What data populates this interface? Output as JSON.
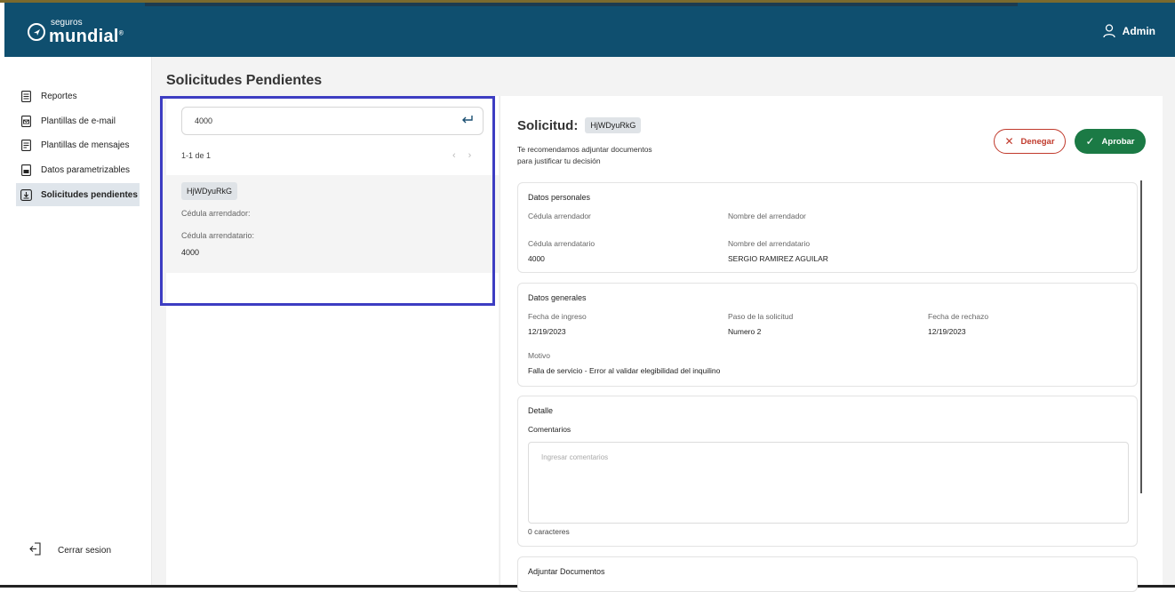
{
  "header": {
    "brand_small": "seguros",
    "brand_big": "mundial",
    "brand_mark": "®",
    "user_label": "Admin"
  },
  "sidebar": {
    "items": [
      {
        "label": "Reportes",
        "icon": "document-icon"
      },
      {
        "label": "Plantillas de e-mail",
        "icon": "email-template-icon"
      },
      {
        "label": "Plantillas de mensajes",
        "icon": "message-template-icon"
      },
      {
        "label": "Datos parametrizables",
        "icon": "settings-data-icon"
      },
      {
        "label": "Solicitudes pendientes",
        "icon": "pending-requests-icon",
        "active": true
      }
    ],
    "logout_label": "Cerrar sesion"
  },
  "page": {
    "title": "Solicitudes Pendientes"
  },
  "list": {
    "search_value": "4000",
    "pager_text": "1-1 de 1",
    "items": [
      {
        "id": "HjWDyuRkG",
        "label_arrendador": "Cédula arrendador:",
        "label_arrendatario": "Cédula arrendatario:",
        "value_arrendatario": "4000"
      }
    ]
  },
  "detail": {
    "title": "Solicitud:",
    "id": "HjWDyuRkG",
    "hint_line1": "Te recomendamos adjuntar documentos",
    "hint_line2": "para justificar tu decisión",
    "deny_label": "Denegar",
    "approve_label": "Aprobar",
    "personal": {
      "title": "Datos personales",
      "cedula_arrendador_label": "Cédula arrendador",
      "nombre_arrendador_label": "Nombre del arrendador",
      "cedula_arrendatario_label": "Cédula arrendatario",
      "cedula_arrendatario_value": "4000",
      "nombre_arrendatario_label": "Nombre del arrendatario",
      "nombre_arrendatario_value": "SERGIO RAMIREZ AGUILAR"
    },
    "general": {
      "title": "Datos generales",
      "fecha_ingreso_label": "Fecha de ingreso",
      "fecha_ingreso_value": "12/19/2023",
      "paso_label": "Paso de la solicitud",
      "paso_value": "Numero 2",
      "fecha_rechazo_label": "Fecha de rechazo",
      "fecha_rechazo_value": "12/19/2023",
      "motivo_label": "Motivo",
      "motivo_value": "Falla de servicio - Error al validar elegibilidad del inquilino"
    },
    "detalle": {
      "title": "Detalle",
      "comentarios_label": "Comentarios",
      "placeholder": "Ingresar comentarios",
      "char_count": "0 caracteres"
    },
    "attach": {
      "title": "Adjuntar Documentos"
    }
  }
}
